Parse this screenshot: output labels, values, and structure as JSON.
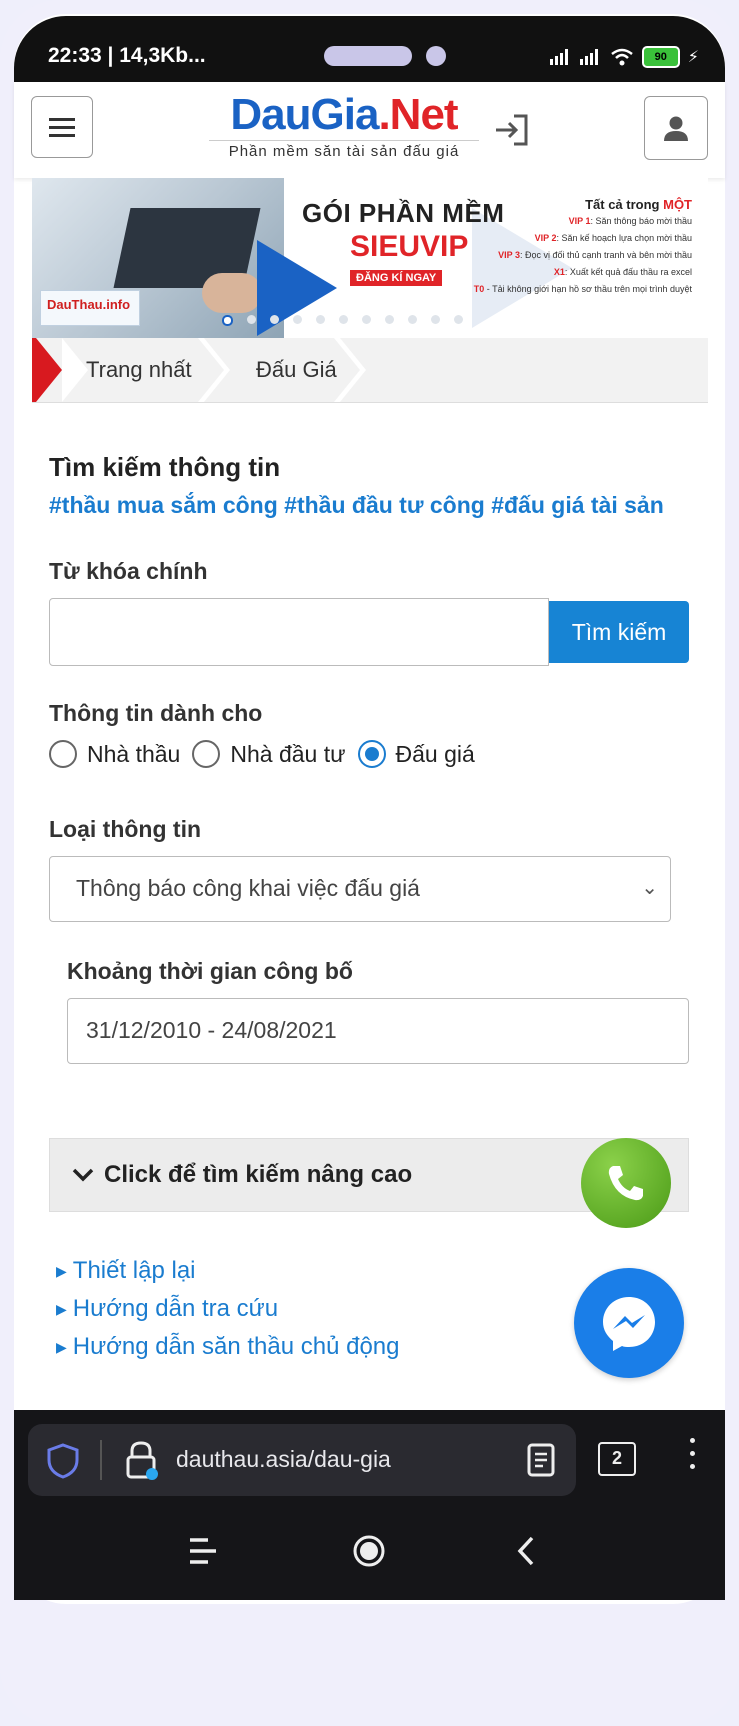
{
  "status_bar": {
    "time": "22:33 | 14,3Kb...",
    "battery": "90"
  },
  "header": {
    "logo_part1": "DauGia",
    "logo_part2": ".Net",
    "tagline": "Phần mềm săn tài sản đấu giá"
  },
  "banner": {
    "badge": "DauThau.info",
    "headline1": "GÓI PHẦN MỀM",
    "headline2": "SIEUVIP",
    "cta": "ĐĂNG KÍ NGAY",
    "list_head": "Tất cả trong",
    "list_head_accent": "MỘT",
    "list_items": [
      {
        "tag": "VIP 1",
        "text": ": Săn thông báo mời thầu"
      },
      {
        "tag": "VIP 2",
        "text": ": Săn kế hoạch lựa chọn mời thầu"
      },
      {
        "tag": "VIP 3",
        "text": ": Đọc vị đối thủ cạnh tranh và bên mời thầu"
      },
      {
        "tag": "X1",
        "text": ": Xuất kết quả đấu thầu ra excel"
      },
      {
        "tag": "T0",
        "text": " - Tải không giới hạn hồ sơ thầu trên mọi trình duyệt"
      }
    ]
  },
  "breadcrumb": {
    "home": "Trang nhất",
    "current": "Đấu Giá"
  },
  "search": {
    "title": "Tìm kiếm thông tin",
    "tags": "#thầu mua sắm công #thầu đầu tư công #đấu giá tài sản",
    "keyword_label": "Từ khóa chính",
    "keyword_value": "",
    "search_button": "Tìm kiếm",
    "audience_label": "Thông tin dành cho",
    "radio_options": [
      "Nhà thầu",
      "Nhà đầu tư",
      "Đấu giá"
    ],
    "radio_selected": "Đấu giá",
    "type_label": "Loại thông tin",
    "type_selected": "Thông báo công khai việc đấu giá",
    "date_label": "Khoảng thời gian công bố",
    "date_value": "31/12/2010 - 24/08/2021",
    "advanced": "Click để tìm kiếm nâng cao"
  },
  "links": [
    "Thiết lập lại",
    "Hướng dẫn tra cứu",
    "Hướng dẫn săn thầu chủ động"
  ],
  "browser": {
    "url": "dauthau.asia/dau-gia",
    "tab_count": "2"
  },
  "colors": {
    "primary": "#1784d4",
    "brand_red": "#e02428",
    "link": "#1a7ccf"
  }
}
